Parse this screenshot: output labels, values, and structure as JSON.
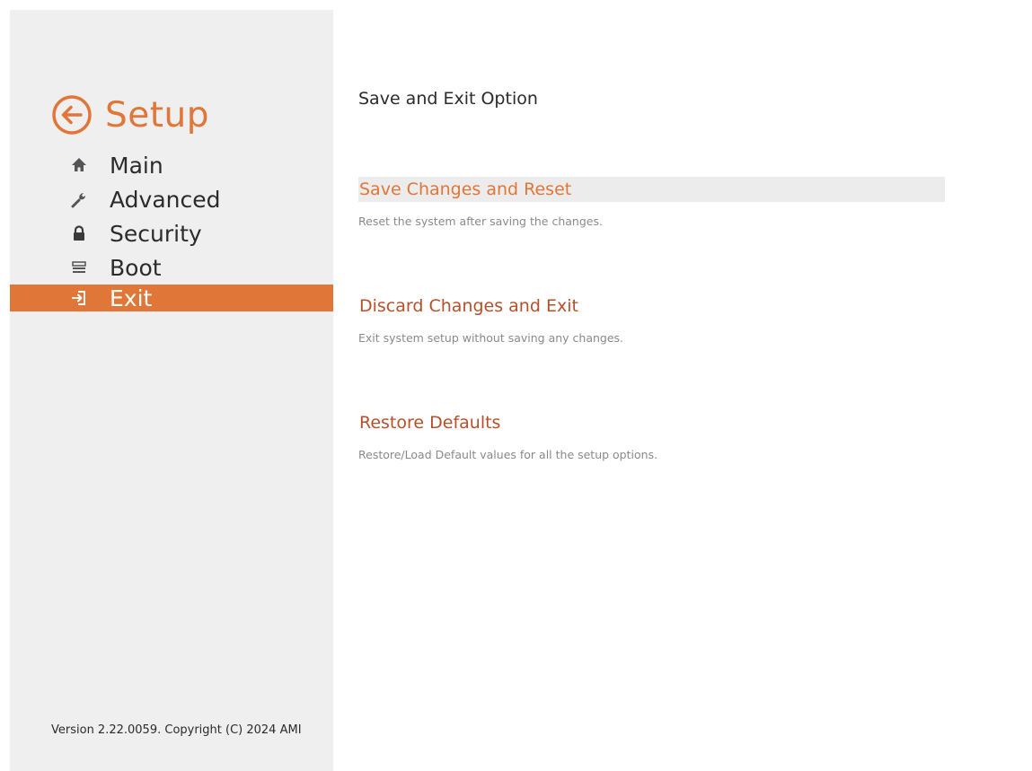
{
  "sidebar": {
    "header": {
      "back_icon": "arrow-left-circle-icon",
      "title": "Setup"
    },
    "items": [
      {
        "label": "Main",
        "icon": "home-icon",
        "active": false
      },
      {
        "label": "Advanced",
        "icon": "wrench-icon",
        "active": false
      },
      {
        "label": "Security",
        "icon": "lock-icon",
        "active": false
      },
      {
        "label": "Boot",
        "icon": "drive-icon",
        "active": false
      },
      {
        "label": "Exit",
        "icon": "exit-icon",
        "active": true
      }
    ]
  },
  "main": {
    "title": "Save and Exit Option",
    "options": [
      {
        "title": "Save Changes and Reset",
        "description": "Reset the system after saving the changes.",
        "selected": true
      },
      {
        "title": "Discard Changes and Exit",
        "description": "Exit system setup without saving any changes.",
        "selected": false
      },
      {
        "title": "Restore Defaults",
        "description": "Restore/Load Default values for all the setup options.",
        "selected": false
      }
    ]
  },
  "footer": {
    "version": "Version 2.22.0059. Copyright (C) 2024 AMI"
  },
  "colors": {
    "accent": "#e07638",
    "option_title": "#b5502a",
    "sidebar_bg": "#efefef",
    "selected_bg": "#ececec",
    "desc_text": "#8a8a8a"
  }
}
